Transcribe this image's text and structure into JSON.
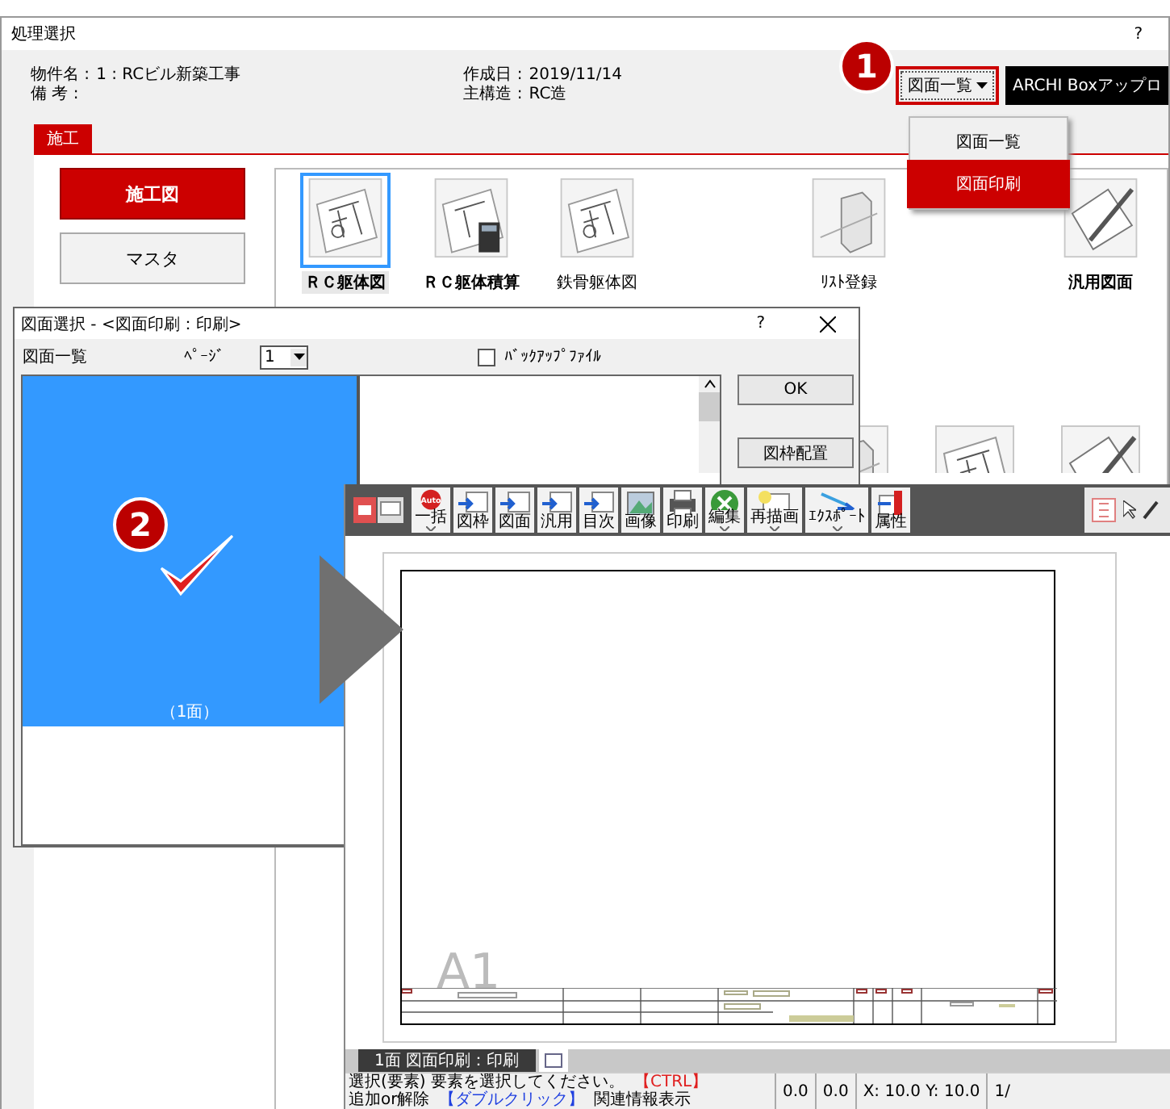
{
  "main_window": {
    "title": "処理選択",
    "help": "?",
    "info": [
      {
        "label": "物件名 :",
        "value": "1 : RCビル新築工事"
      },
      {
        "label": "備 考 :"
      },
      {
        "label": "作成日 :",
        "value": "2019/11/14"
      },
      {
        "label": "主構造 :",
        "value": "RC造"
      }
    ],
    "drawing_list_button": "図面一覧",
    "upload_button": "ARCHI Boxアップロ",
    "dropdown_menu": [
      {
        "label": "図面一覧",
        "selected": false
      },
      {
        "label": "図面印刷",
        "selected": true
      }
    ],
    "tabs": [
      {
        "label": "施工",
        "selected": true
      }
    ],
    "side_buttons": [
      {
        "label": "施工図",
        "selected": true
      },
      {
        "label": "マスタ",
        "selected": false
      }
    ],
    "tiles": [
      {
        "label": "ＲＣ躯体図",
        "kind": "plan",
        "bold": true,
        "selected": true
      },
      {
        "label": "ＲＣ躯体積算",
        "kind": "estimate",
        "bold": true,
        "selected": false
      },
      {
        "label": "鉄骨躯体図",
        "kind": "plan",
        "bold": false,
        "selected": false
      },
      {
        "kind": "empty"
      },
      {
        "label": "ﾘｽﾄ登録",
        "kind": "list",
        "bold": false,
        "selected": false
      },
      {
        "kind": "empty"
      },
      {
        "label": "汎用図面",
        "kind": "general",
        "bold": true,
        "selected": false
      }
    ]
  },
  "dialog": {
    "title": "図面選択 - <図面印刷：印刷>",
    "help": "?",
    "list_label": "図面一覧",
    "page_label": "ﾍﾟｰｼﾞ",
    "page_value": "1",
    "backup_checkbox": {
      "label": "ﾊﾞｯｸｱｯﾌﾟﾌｧｲﾙ",
      "checked": false
    },
    "sheets": [
      {
        "label": "（1面）",
        "selected": true
      }
    ],
    "buttons": [
      "OK",
      "図枠配置"
    ]
  },
  "callouts": [
    {
      "number": "1"
    },
    {
      "number": "2"
    }
  ],
  "print_window": {
    "toolbar": [
      {
        "label": "一括",
        "kind": "auto",
        "icon_text": "Auto",
        "dropdown": true
      },
      {
        "label": "図枠",
        "kind": "frame",
        "dropdown": false
      },
      {
        "label": "図面",
        "kind": "sheet",
        "dropdown": false
      },
      {
        "label": "汎用",
        "kind": "general",
        "dropdown": false
      },
      {
        "label": "目次",
        "kind": "contents",
        "dropdown": false
      },
      {
        "label": "画像",
        "kind": "image",
        "dropdown": false
      },
      {
        "label": "印刷",
        "kind": "print",
        "dropdown": false
      },
      {
        "label": "編集",
        "kind": "edit",
        "dropdown": true
      },
      {
        "label": "再描画",
        "kind": "redraw",
        "dropdown": true
      },
      {
        "label": "ｴｸｽﾎﾟｰﾄ",
        "kind": "export",
        "dropdown": true
      },
      {
        "label": "属性",
        "kind": "attribute",
        "dropdown": false
      }
    ],
    "sheet_size": "A1",
    "tabs": [
      {
        "label": "1面 図面印刷：印刷",
        "selected": true
      }
    ],
    "status_bar": {
      "messages": [
        {
          "text": "選択(要素) 要素を選択してください。",
          "color": "#000000"
        },
        {
          "text": "【CTRL】",
          "color": "#e02020"
        },
        {
          "text": "追加or解除",
          "color": "#000000"
        },
        {
          "text": "【ダブルクリック】",
          "color": "#2040e0"
        },
        {
          "text": "関連情報表示",
          "color": "#000000"
        }
      ],
      "cells": [
        "0.0",
        "0.0",
        "X: 10.0 Y: 10.0",
        "1/"
      ]
    }
  }
}
